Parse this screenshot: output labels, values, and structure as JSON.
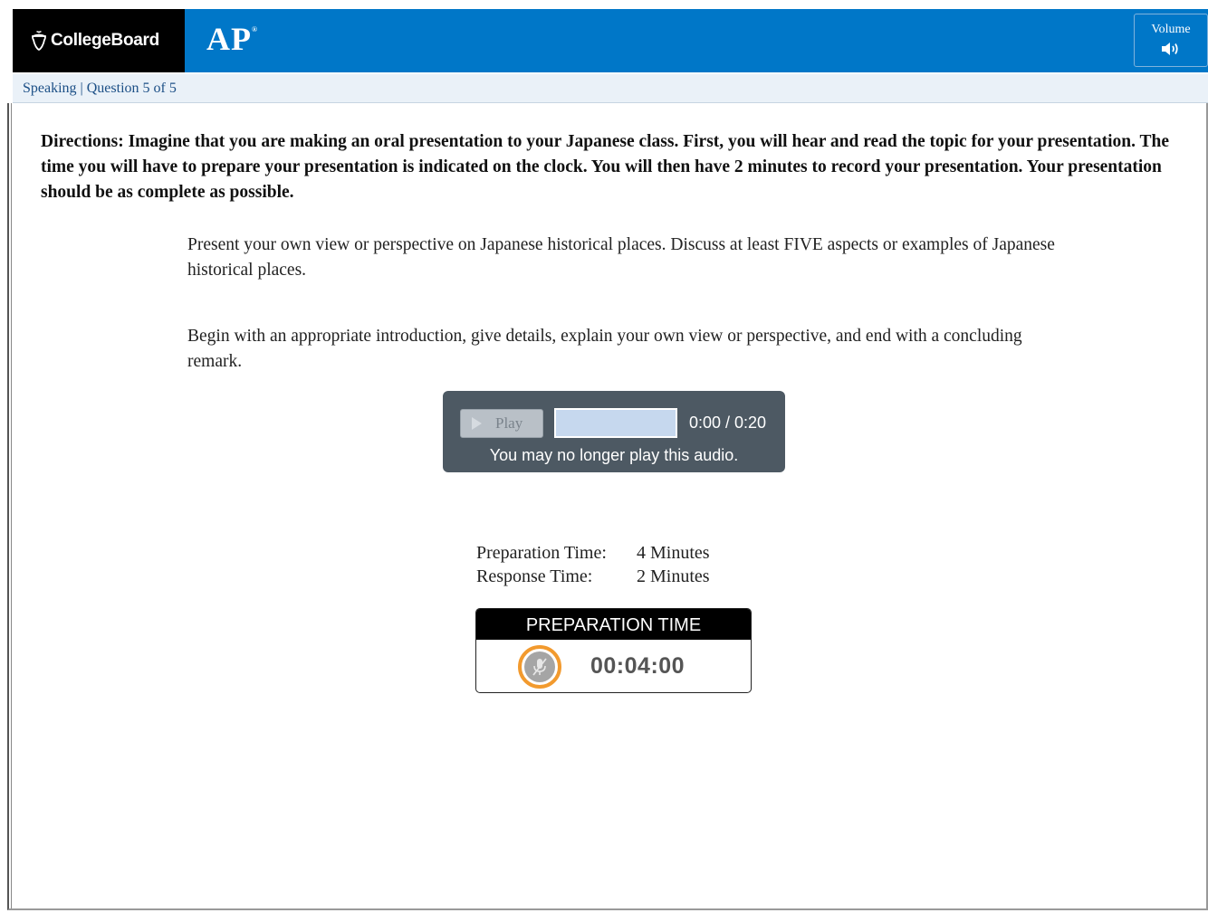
{
  "header": {
    "brand": "CollegeBoard",
    "product": "AP",
    "product_mark": "®",
    "volume_label": "Volume"
  },
  "breadcrumb": {
    "text": "Speaking | Question 5 of 5"
  },
  "directions": "Directions: Imagine that you are making an oral presentation to your Japanese class. First, you will hear and read the topic for your presentation. The time you will have to prepare your presentation is indicated on the clock. You will then have 2 minutes to record your presentation. Your presentation should be as complete as possible.",
  "prompt": {
    "paragraph1": "Present your own view or perspective on Japanese historical places.  Discuss at least FIVE aspects or examples of Japanese historical places.",
    "paragraph2": "Begin with an appropriate introduction, give details, explain your own view or perspective, and end with a concluding remark."
  },
  "audio": {
    "play_label": "Play",
    "time": "0:00 / 0:20",
    "message": "You may no longer play this audio.",
    "progress": 0,
    "enabled": false
  },
  "timing": {
    "prep_label": "Preparation Time:",
    "prep_value": "4 Minutes",
    "response_label": "Response Time:",
    "response_value": "2 Minutes"
  },
  "timer": {
    "header": "PREPARATION TIME",
    "clock": "00:04:00",
    "mic_state": "muted"
  },
  "colors": {
    "brand_blue": "#0077c8",
    "player_bg": "#4d5963",
    "mic_ring": "#f29a2e"
  },
  "icons": {
    "brand": "acorn-icon",
    "volume": "speaker-icon",
    "play": "play-icon",
    "mic": "mic-muted-icon"
  }
}
